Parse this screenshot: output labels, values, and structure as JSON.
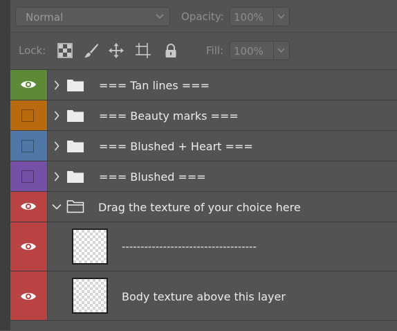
{
  "blend_mode": {
    "value": "Normal"
  },
  "opacity": {
    "label": "Opacity:",
    "value": "100%"
  },
  "lock": {
    "label": "Lock:"
  },
  "fill": {
    "label": "Fill:",
    "value": "100%"
  },
  "layers": [
    {
      "name": "=== Tan lines ===",
      "color": "#5e8a38",
      "visible": true,
      "type": "group",
      "expanded": false
    },
    {
      "name": "=== Beauty marks ===",
      "color": "#b86a0f",
      "visible": false,
      "type": "group",
      "expanded": false
    },
    {
      "name": "=== Blushed + Heart ===",
      "color": "#4f77a6",
      "visible": false,
      "type": "group",
      "expanded": false
    },
    {
      "name": "=== Blushed ===",
      "color": "#7450a6",
      "visible": false,
      "type": "group",
      "expanded": false
    },
    {
      "name": "Drag the texture of your choice here",
      "color": "#b94343",
      "visible": true,
      "type": "group",
      "expanded": true
    },
    {
      "name": "------------------------------------",
      "color": "#b94343",
      "visible": true,
      "type": "layer"
    },
    {
      "name": "Body texture above this layer",
      "color": "#b94343",
      "visible": true,
      "type": "layer"
    }
  ],
  "icons": {
    "lock_transparent": "checkerboard-icon",
    "lock_image": "brush-icon",
    "lock_position": "move-icon",
    "lock_artboard": "artboard-icon",
    "lock_all": "padlock-icon"
  }
}
